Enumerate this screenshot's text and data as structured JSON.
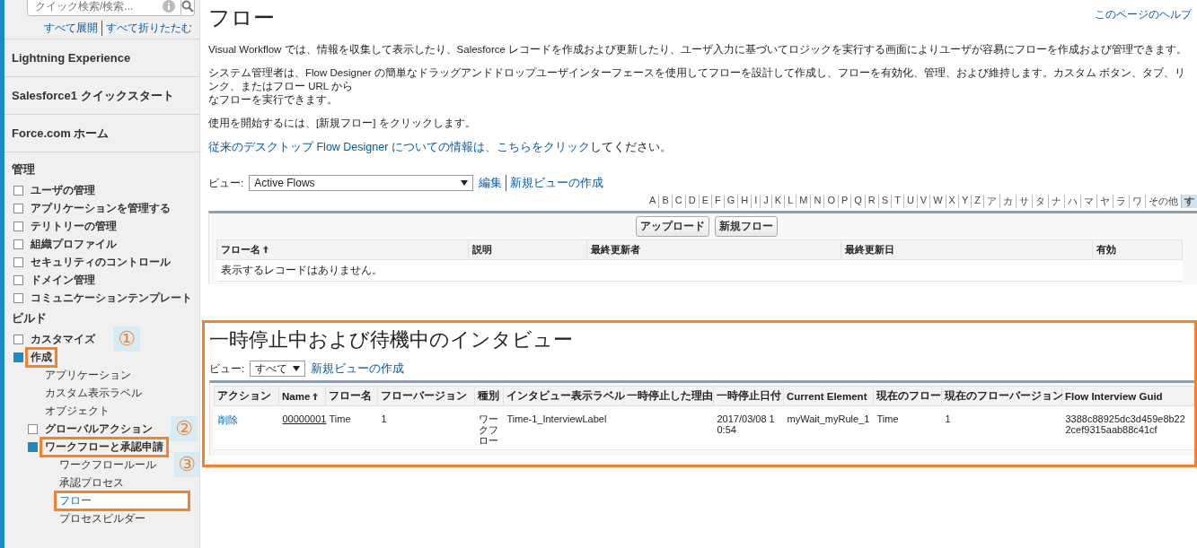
{
  "sidebar": {
    "search": {
      "placeholder": "クイック検索/検索..."
    },
    "expand_links": [
      "すべて展開",
      "すべて折りたたむ"
    ],
    "top_items": [
      "Lightning Experience",
      "Salesforce1 クイックスタート",
      "Force.com ホーム"
    ],
    "sections": [
      {
        "heading": "管理",
        "items": [
          {
            "kind": "folder",
            "label": "ユーザの管理",
            "expanded": false,
            "selected": false,
            "highlighted": false
          },
          {
            "kind": "folder",
            "label": "アプリケーションを管理する",
            "expanded": false,
            "selected": false,
            "highlighted": false
          },
          {
            "kind": "folder",
            "label": "テリトリーの管理",
            "expanded": false,
            "selected": false,
            "highlighted": false
          },
          {
            "kind": "folder",
            "label": "組織プロファイル",
            "expanded": false,
            "selected": false,
            "highlighted": false
          },
          {
            "kind": "folder",
            "label": "セキュリティのコントロール",
            "expanded": false,
            "selected": false,
            "highlighted": false
          },
          {
            "kind": "folder",
            "label": "ドメイン管理",
            "expanded": false,
            "selected": false,
            "highlighted": false
          },
          {
            "kind": "folder",
            "label": "コミュニケーションテンプレート",
            "expanded": false,
            "selected": false,
            "highlighted": false
          }
        ]
      },
      {
        "heading": "ビルド",
        "items": [
          {
            "kind": "folder",
            "label": "カスタマイズ",
            "expanded": false,
            "selected": false,
            "highlighted": false,
            "callout": "①"
          },
          {
            "kind": "folder",
            "label": "作成",
            "expanded": true,
            "selected": false,
            "highlighted": true,
            "children": [
              {
                "kind": "link",
                "label": "アプリケーション",
                "selected": false,
                "highlighted": false
              },
              {
                "kind": "link",
                "label": "カスタム表示ラベル",
                "selected": false,
                "highlighted": false
              },
              {
                "kind": "link",
                "label": "オブジェクト",
                "selected": false,
                "highlighted": false
              },
              {
                "kind": "folder",
                "label": "グローバルアクション",
                "expanded": false,
                "selected": false,
                "highlighted": false,
                "callout": "②"
              },
              {
                "kind": "folder",
                "label": "ワークフローと承認申請",
                "expanded": true,
                "selected": false,
                "highlighted": true,
                "children": [
                  {
                    "kind": "link",
                    "label": "ワークフロールール",
                    "selected": false,
                    "highlighted": false,
                    "callout": "③"
                  },
                  {
                    "kind": "link",
                    "label": "承認プロセス",
                    "selected": false,
                    "highlighted": false
                  },
                  {
                    "kind": "link",
                    "label": "フロー",
                    "selected": true,
                    "highlighted": true
                  },
                  {
                    "kind": "link",
                    "label": "プロセスビルダー",
                    "selected": false,
                    "highlighted": false
                  }
                ]
              }
            ]
          }
        ]
      }
    ]
  },
  "main": {
    "title": "フロー",
    "help_link": "このページのヘルプ",
    "paragraphs": [
      [
        "Visual Workflow では、情報を収集して表示したり、Salesforce レコードを作成および更新したり、ユーザ入力に基づいてロジックを実行する画面によりユーザが容易にフローを作成および管理できます。"
      ],
      [
        "システム管理者は、Flow Designer の簡単なドラッグアンドドロップユーザインターフェースを使用してフローを設計して作成し、フローを有効化、管理、および維持します。カスタム ボタン、タブ、リンク、またはフロー URL から",
        "なフローを実行できます。"
      ],
      [
        "使用を開始するには、[新規フロー] をクリックします。"
      ]
    ],
    "info_link": "従来のデスクトップ Flow Designer についての情報は、こちらをクリック",
    "info_suffix": "してください。",
    "view": {
      "label": "ビュー:",
      "value": "Active Flows",
      "links": [
        "編集",
        "新規ビューの作成"
      ]
    },
    "alphabet": [
      {
        "label": "A",
        "selected": false
      },
      {
        "label": "B",
        "selected": false
      },
      {
        "label": "C",
        "selected": false
      },
      {
        "label": "D",
        "selected": false
      },
      {
        "label": "E",
        "selected": false
      },
      {
        "label": "F",
        "selected": false
      },
      {
        "label": "G",
        "selected": false
      },
      {
        "label": "H",
        "selected": false
      },
      {
        "label": "I",
        "selected": false
      },
      {
        "label": "J",
        "selected": false
      },
      {
        "label": "K",
        "selected": false
      },
      {
        "label": "L",
        "selected": false
      },
      {
        "label": "M",
        "selected": false
      },
      {
        "label": "N",
        "selected": false
      },
      {
        "label": "O",
        "selected": false
      },
      {
        "label": "P",
        "selected": false
      },
      {
        "label": "Q",
        "selected": false
      },
      {
        "label": "R",
        "selected": false
      },
      {
        "label": "S",
        "selected": false
      },
      {
        "label": "T",
        "selected": false
      },
      {
        "label": "U",
        "selected": false
      },
      {
        "label": "V",
        "selected": false
      },
      {
        "label": "W",
        "selected": false
      },
      {
        "label": "X",
        "selected": false
      },
      {
        "label": "Y",
        "selected": false
      },
      {
        "label": "Z",
        "selected": false
      },
      {
        "label": "ア",
        "selected": false
      },
      {
        "label": "カ",
        "selected": false
      },
      {
        "label": "サ",
        "selected": false
      },
      {
        "label": "タ",
        "selected": false
      },
      {
        "label": "ナ",
        "selected": false
      },
      {
        "label": "ハ",
        "selected": false
      },
      {
        "label": "マ",
        "selected": false
      },
      {
        "label": "ヤ",
        "selected": false
      },
      {
        "label": "ラ",
        "selected": false
      },
      {
        "label": "ワ",
        "selected": false
      },
      {
        "label": "その他",
        "selected": false
      },
      {
        "label": "す",
        "selected": true
      }
    ],
    "flows_table": {
      "buttons": [
        "アップロード",
        "新規フロー"
      ],
      "columns": [
        {
          "label": "フロー名",
          "sorted": true
        },
        {
          "label": "説明",
          "sorted": false
        },
        {
          "label": "最終更新者",
          "sorted": false
        },
        {
          "label": "最終更新日",
          "sorted": false
        },
        {
          "label": "有効",
          "sorted": false
        }
      ],
      "empty_message": "表示するレコードはありません。"
    },
    "interviews": {
      "title": "一時停止中および待機中のインタビュー",
      "highlighted": true,
      "view": {
        "label": "ビュー:",
        "value": "すべて",
        "link": "新規ビューの作成"
      },
      "columns": [
        {
          "label": "アクション",
          "sorted": false
        },
        {
          "label": "Name",
          "sorted": true
        },
        {
          "label": "フロー名",
          "sorted": false
        },
        {
          "label": "フローバージョン",
          "sorted": false
        },
        {
          "label": "種別",
          "sorted": false
        },
        {
          "label": "インタビュー表示ラベル",
          "sorted": false
        },
        {
          "label": "一時停止した理由",
          "sorted": false
        },
        {
          "label": "一時停止日付",
          "sorted": false
        },
        {
          "label": "Current Element",
          "sorted": false
        },
        {
          "label": "現在のフロー",
          "sorted": false
        },
        {
          "label": "現在のフローバージョン",
          "sorted": false
        },
        {
          "label": "Flow Interview Guid",
          "sorted": false
        }
      ],
      "rows": [
        {
          "action": "削除",
          "name": "00000001",
          "flow_name": "Time",
          "flow_version": "1",
          "type": "ワークフロー",
          "label": "Time-1_InterviewLabel",
          "pause_reason": "",
          "paused_date": "2017/03/08 10:54",
          "current_element": "myWait_myRule_1",
          "current_flow": "Time",
          "current_flow_version": "1",
          "guid": "3388c88925dc3d459e8b222cef9315aab88c41cf"
        }
      ]
    }
  }
}
